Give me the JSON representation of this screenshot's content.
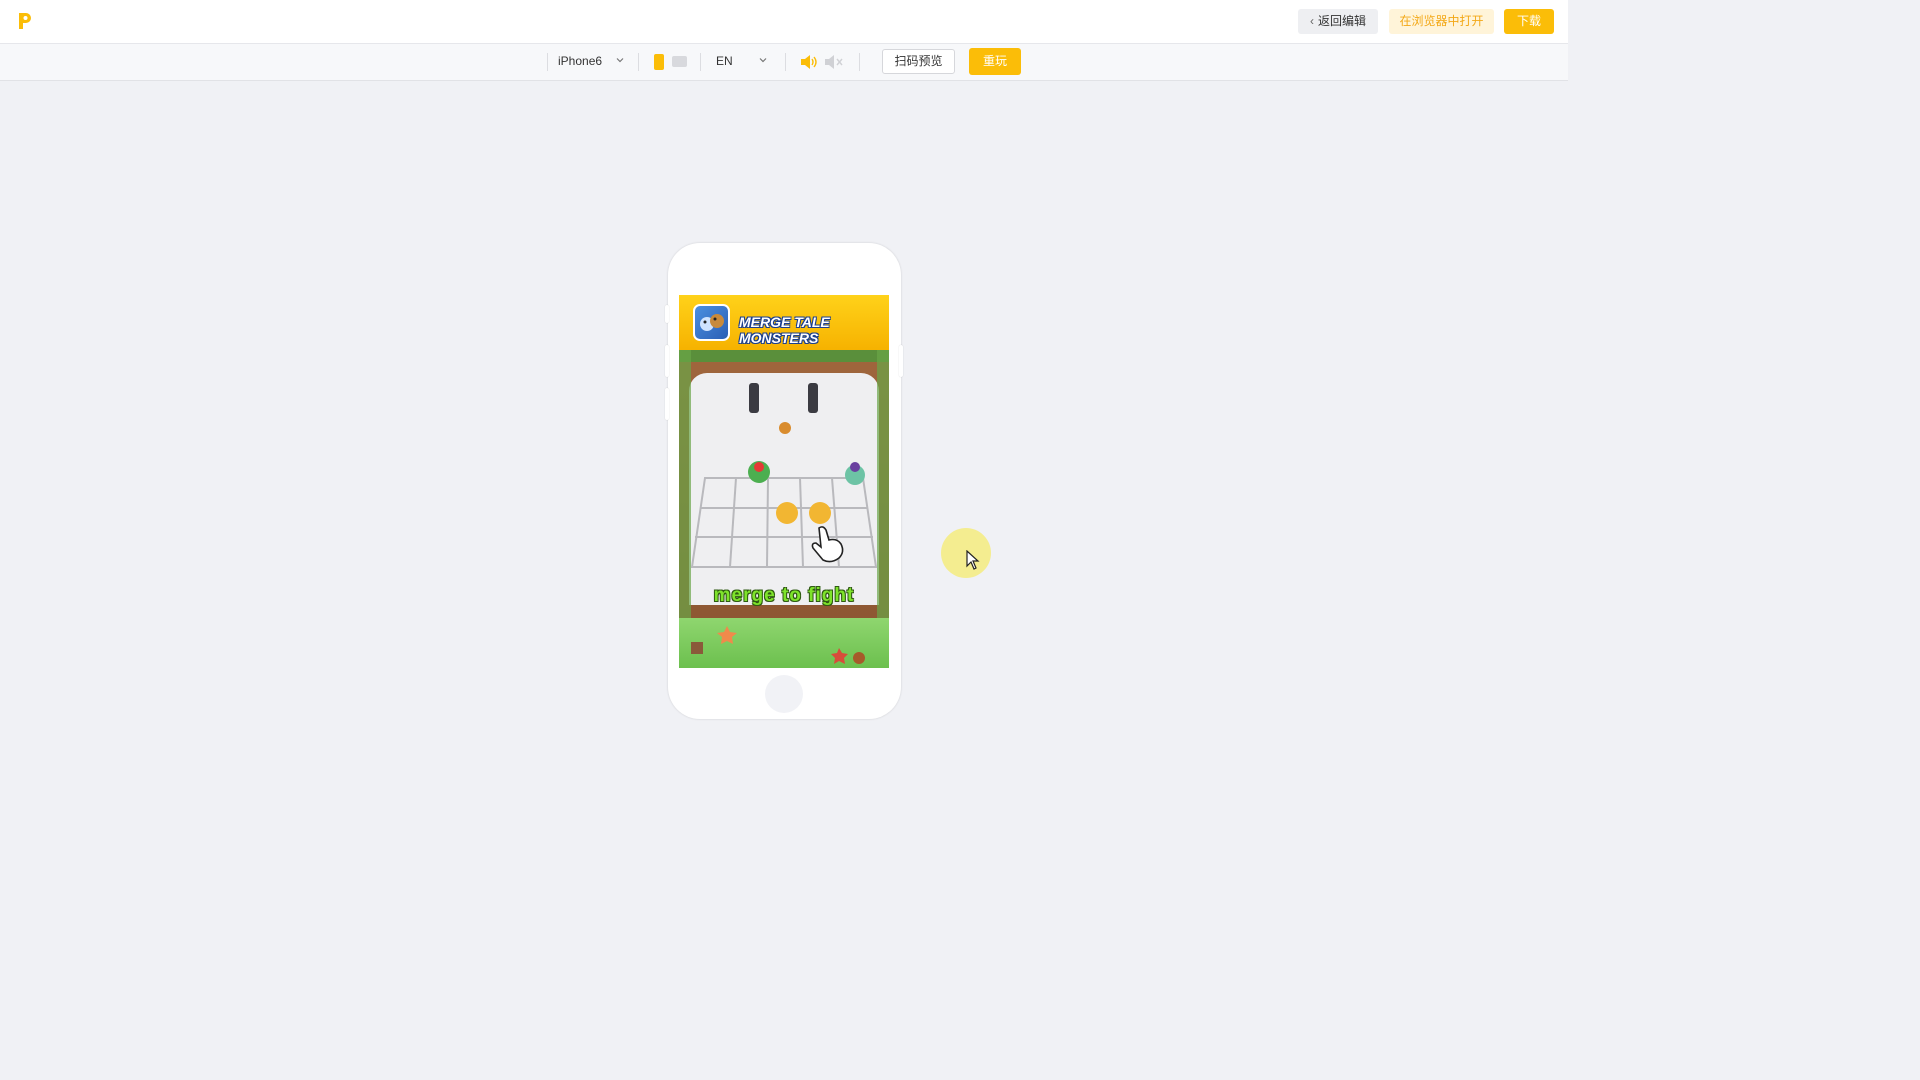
{
  "app": {
    "logo_icon": "brand-p-logo",
    "brand_color": "#fbbd08"
  },
  "header": {
    "back_label": "返回编辑",
    "open_browser_label": "在浏览器中打开",
    "download_label": "下载"
  },
  "toolbar": {
    "device_selected": "iPhone6",
    "orientation": "portrait",
    "language_selected": "EN",
    "sound": "on",
    "scan_preview_label": "扫码预览",
    "replay_label": "重玩"
  },
  "preview": {
    "game_title": "MERGE TALE MONSTERS",
    "caption": "merge to fight"
  }
}
